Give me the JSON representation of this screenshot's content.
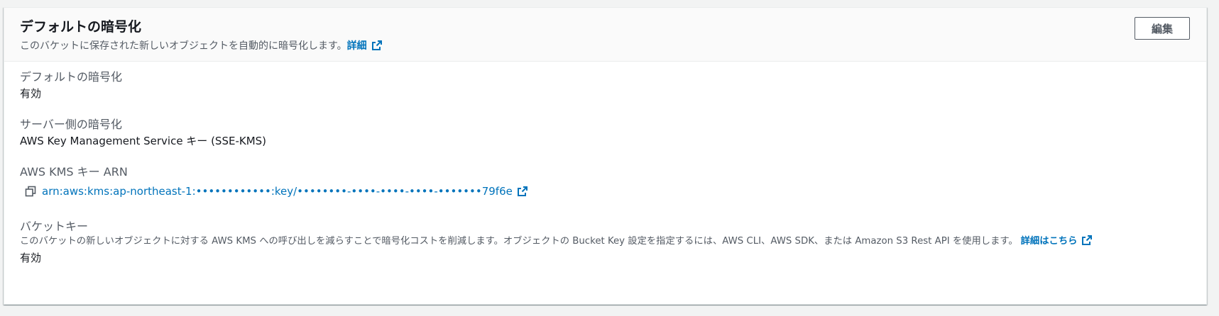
{
  "header": {
    "title": "デフォルトの暗号化",
    "description": "このバケットに保存された新しいオブジェクトを自動的に暗号化します。",
    "details_link": "詳細",
    "edit_button": "編集"
  },
  "fields": {
    "default_encryption": {
      "label": "デフォルトの暗号化",
      "value": "有効"
    },
    "server_side_encryption": {
      "label": "サーバー側の暗号化",
      "value": "AWS Key Management Service キー (SSE-KMS)"
    },
    "kms_key_arn": {
      "label": "AWS KMS キー ARN",
      "value": "arn:aws:kms:ap-northeast-1:••••••••••••:key/••••••••-••••-••••-••••-•••••••79f6e"
    },
    "bucket_key": {
      "label": "バケットキー",
      "description": "このバケットの新しいオブジェクトに対する AWS KMS への呼び出しを減らすことで暗号化コストを削減します。オブジェクトの Bucket Key 設定を指定するには、AWS CLI、AWS SDK、または Amazon S3 Rest API を使用します。",
      "learn_more_link": "詳細はこちら",
      "value": "有効"
    }
  },
  "icons": {
    "external_link": "external-link-icon",
    "copy": "copy-icon"
  },
  "colors": {
    "link": "#0073bb",
    "text": "#16191f",
    "secondary_text": "#545b64",
    "header_bg": "#fafafa",
    "page_bg": "#f2f3f3"
  }
}
